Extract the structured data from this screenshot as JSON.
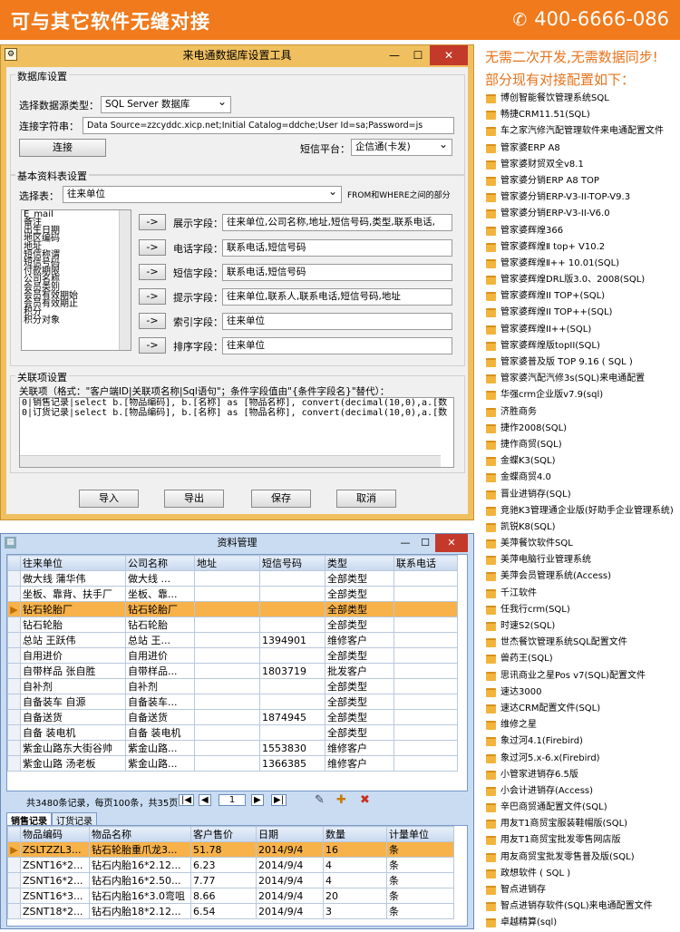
{
  "banner": {
    "title": "可与其它软件无缝对接",
    "phone": "400-6666-086"
  },
  "config": {
    "title": "来电通数据库设置工具",
    "db_group": "数据库设置",
    "db_type_label": "选择数据源类型：",
    "db_type_value": "SQL Server 数据库",
    "conn_label": "连接字符串：",
    "conn_value": "Data Source=zzcyddc.xicp.net;Initial Catalog=ddche;User Id=sa;Password=js",
    "connect_btn": "连接",
    "sms_label": "短信平台：",
    "sms_value": "企信通(卡发)",
    "basic_group": "基本资料表设置",
    "table_label": "选择表：",
    "table_value": "往来单位",
    "from_note": "FROM和WHERE之间的部分",
    "fields": [
      "E_mail",
      "备注",
      "出生日期",
      "地区编码",
      "地址",
      "短信称谓",
      "短信号码",
      "付款期限",
      "公司名称",
      "会员类别",
      "会员有效期始",
      "会员有效期止",
      "积分",
      "积分对象"
    ],
    "arrow": "->",
    "mappings": [
      {
        "label": "展示字段：",
        "value": "往来单位,公司名称,地址,短信号码,类型,联系电话,"
      },
      {
        "label": "电话字段：",
        "value": "联系电话,短信号码"
      },
      {
        "label": "短信字段：",
        "value": "联系电话,短信号码"
      },
      {
        "label": "提示字段：",
        "value": "往来单位,联系人,联系电话,短信号码,地址"
      },
      {
        "label": "索引字段：",
        "value": "往来单位"
      },
      {
        "label": "排序字段：",
        "value": "往来单位"
      }
    ],
    "rel_group": "关联项设置",
    "rel_note": "关联项（格式：\"客户端ID|关联项名称|Sql语句\"；条件字段值由\"{条件字段名}\"替代）：",
    "rel_lines": [
      "0|销售记录|select b.[物品编码], b.[名称] as [物品名称], convert(decimal(10,0),a.[数",
      "0|订货记录|select b.[物品编码], b.[名称] as [物品名称], convert(decimal(10,0),a.[数"
    ],
    "buttons": [
      "导入",
      "导出",
      "保存",
      "取消"
    ]
  },
  "records": {
    "title": "资料管理",
    "columns": [
      "往来单位",
      "公司名称",
      "地址",
      "短信号码",
      "类型",
      "联系电话"
    ],
    "rows": [
      [
        "做大线 蒲华伟",
        "做大线 ...",
        "",
        "",
        "全部类型",
        ""
      ],
      [
        "坐板、靠背、扶手厂",
        "坐板、靠...",
        "",
        "",
        "全部类型",
        ""
      ],
      [
        "钻石轮胎厂",
        "钻石轮胎厂",
        "",
        "",
        "全部类型",
        ""
      ],
      [
        "钻石轮胎",
        "钻石轮胎",
        "",
        "",
        "全部类型",
        ""
      ],
      [
        "总站 王跃伟",
        "总站 王...",
        "",
        "1394901",
        "维修客户",
        ""
      ],
      [
        "自用进价",
        "自用进价",
        "",
        "",
        "全部类型",
        ""
      ],
      [
        "自带样品 张自胜",
        "自带样品...",
        "",
        "1803719",
        "批发客户",
        ""
      ],
      [
        "自补剂",
        "自补剂",
        "",
        "",
        "全部类型",
        ""
      ],
      [
        "自备装车 自源",
        "自备装车...",
        "",
        "",
        "全部类型",
        ""
      ],
      [
        "自备送货",
        "自备送货",
        "",
        "1874945",
        "全部类型",
        ""
      ],
      [
        "自备 装电机",
        "自备 装电机",
        "",
        "",
        "全部类型",
        ""
      ],
      [
        "紫金山路东大街谷帅",
        "紫金山路...",
        "",
        "1553830",
        "维修客户",
        ""
      ],
      [
        "紫金山路 汤老板",
        "紫金山路...",
        "",
        "1366385",
        "维修客户",
        ""
      ]
    ],
    "selected_row": 2,
    "status": "共3480条记录，每页100条，共35页",
    "page": "1",
    "tabs": [
      "销售记录",
      "订货记录"
    ],
    "sub_columns": [
      "物品编码",
      "物品名称",
      "客户售价",
      "日期",
      "数量",
      "计量单位"
    ],
    "sub_rows": [
      [
        "ZSLTZZL3...",
        "钻石轮胎重爪龙3...",
        "51.78",
        "2014/9/4",
        "16",
        "条"
      ],
      [
        "ZSNT16*2...",
        "钻石内胎16*2.12...",
        "6.23",
        "2014/9/4",
        "4",
        "条"
      ],
      [
        "ZSNT16*2...",
        "钻石内胎16*2.50...",
        "7.77",
        "2014/9/4",
        "4",
        "条"
      ],
      [
        "ZSNT16*3...",
        "钻石内胎16*3.0弯咀",
        "8.66",
        "2014/9/4",
        "20",
        "条"
      ],
      [
        "ZSNT18*2...",
        "钻石内胎18*2.12...",
        "6.54",
        "2014/9/4",
        "3",
        "条"
      ]
    ]
  },
  "right": {
    "headline1": "无需二次开发,无需数据同步!",
    "headline2": "部分现有对接配置如下：",
    "items": [
      "博创智能餐饮管理系统SQL",
      "畅捷CRM11.51(SQL)",
      "车之家汽修汽配管理软件来电通配置文件",
      "管家婆ERP A8",
      "管家婆财贸双全v8.1",
      "管家婆分销ERP A8 TOP",
      "管家婆分销ERP-V3-II-TOP-V9.3",
      "管家婆分销ERP-V3-II-V6.0",
      "管家婆辉煌366",
      "管家婆辉煌Ⅱ top+ V10.2",
      "管家婆辉煌Ⅱ++ 10.01(SQL)",
      "管家婆辉煌DRL版3.0、2008(SQL)",
      "管家婆辉煌II TOP+(SQL)",
      "管家婆辉煌II TOP++(SQL)",
      "管家婆辉煌II++(SQL)",
      "管家婆辉煌版topII(SQL)",
      "管家婆普及版 TOP 9.16 ( SQL )",
      "管家婆汽配汽修3s(SQL)来电通配置",
      "华强crm企业版v7.9(sql)",
      "济胜商务",
      "捷作2008(SQL)",
      "捷作商贸(SQL)",
      "金蝶K3(SQL)",
      "金蝶商贸4.0",
      "晋业进销存(SQL)",
      "竞驰K3管理通企业版(好助手企业管理系统)",
      "凯锐K8(SQL)",
      "美萍餐饮软件SQL",
      "美萍电脑行业管理系统",
      "美萍会员管理系统(Access)",
      "千江软件",
      "任我行crm(SQL)",
      "时速S2(SQL)",
      "世杰餐饮管理系统SQL配置文件",
      "兽药王(SQL)",
      "思讯商业之星Pos v7(SQL)配置文件",
      "速达3000",
      "速达CRM配置文件(SQL)",
      "维修之星",
      "象过河4.1(Firebird)",
      "象过河5.x-6.x(Firebird)",
      "小管家进销存6.5版",
      "小会计进销存(Access)",
      "辛巴商贸通配置文件(SQL)",
      "用友T1商贸宝服装鞋帽版(SQL)",
      "用友T1商贸宝批发零售网店版",
      "用友商贸宝批发零售普及版(SQL)",
      "政想软件 ( SQL )",
      "智点进销存",
      "智点进销存软件(SQL)来电通配置文件",
      "卓越精算(sql)"
    ]
  }
}
